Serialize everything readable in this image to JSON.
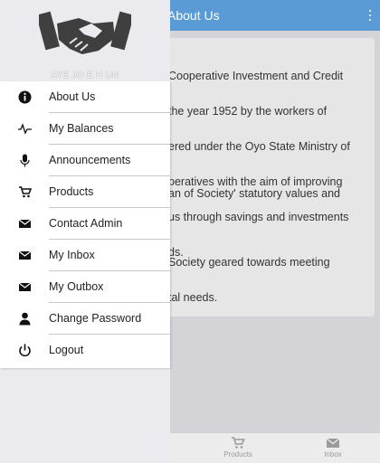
{
  "header": {
    "title": "About Us",
    "menu_icon": "more-vert-icon"
  },
  "content": {
    "lines_block1": [
      "Cooperative Investment and Credit",
      "the year 1952 by the workers of",
      "ered under the Oyo State Ministry of",
      "peratives with the aim of improving",
      "us through savings and investments",
      "ds."
    ],
    "lines_block2": [
      "an of Society' statutory values and"
    ],
    "lines_block3": [
      "Society geared towards meeting",
      "tal needs."
    ]
  },
  "drawer": {
    "brand": "AYE JO E H UN",
    "logo_icon": "handshake-icon",
    "items": [
      {
        "label": "About Us",
        "icon": "info-icon"
      },
      {
        "label": "My Balances",
        "icon": "activity-icon"
      },
      {
        "label": "Announcements",
        "icon": "microphone-icon"
      },
      {
        "label": "Products",
        "icon": "cart-icon"
      },
      {
        "label": "Contact Admin",
        "icon": "mail-icon"
      },
      {
        "label": "My Inbox",
        "icon": "mail-icon"
      },
      {
        "label": "My Outbox",
        "icon": "mail-icon"
      },
      {
        "label": "Change Password",
        "icon": "user-icon"
      },
      {
        "label": "Logout",
        "icon": "power-icon"
      }
    ]
  },
  "tabbar": {
    "tabs": [
      {
        "label": "Products",
        "icon": "cart-icon"
      },
      {
        "label": "Inbox",
        "icon": "mail-icon"
      }
    ]
  },
  "colors": {
    "header": "#5b9bd5",
    "drawer": "#eaeaef",
    "menu": "#ffffff"
  }
}
